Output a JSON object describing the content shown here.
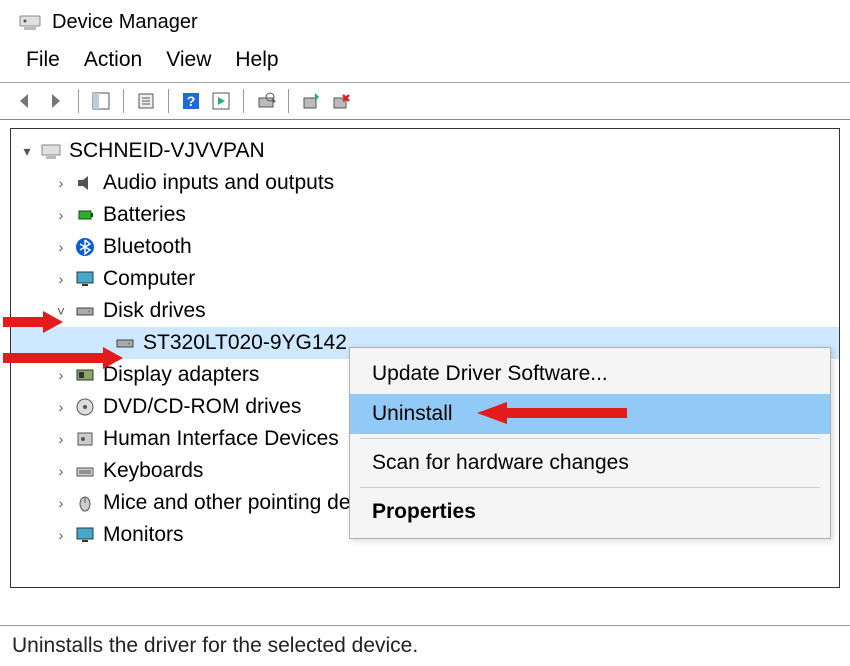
{
  "window": {
    "title": "Device Manager"
  },
  "menubar": {
    "file": "File",
    "action": "Action",
    "view": "View",
    "help": "Help"
  },
  "tree": {
    "root": "SCHNEID-VJVVPAN",
    "items": [
      {
        "label": "Audio inputs and outputs",
        "icon": "speaker"
      },
      {
        "label": "Batteries",
        "icon": "battery"
      },
      {
        "label": "Bluetooth",
        "icon": "bluetooth"
      },
      {
        "label": "Computer",
        "icon": "monitor"
      },
      {
        "label": "Disk drives",
        "icon": "disk",
        "expanded": true,
        "children": [
          {
            "label": "ST320LT020-9YG142",
            "icon": "disk",
            "selected": true
          }
        ]
      },
      {
        "label": "Display adapters",
        "icon": "display-adapter"
      },
      {
        "label": "DVD/CD-ROM drives",
        "icon": "optical"
      },
      {
        "label": "Human Interface Devices",
        "icon": "hid"
      },
      {
        "label": "Keyboards",
        "icon": "keyboard"
      },
      {
        "label": "Mice and other pointing devices",
        "icon": "mouse"
      },
      {
        "label": "Monitors",
        "icon": "monitor2"
      }
    ]
  },
  "context_menu": {
    "update": "Update Driver Software...",
    "uninstall": "Uninstall",
    "scan": "Scan for hardware changes",
    "properties": "Properties"
  },
  "status": "Uninstalls the driver for the selected device."
}
